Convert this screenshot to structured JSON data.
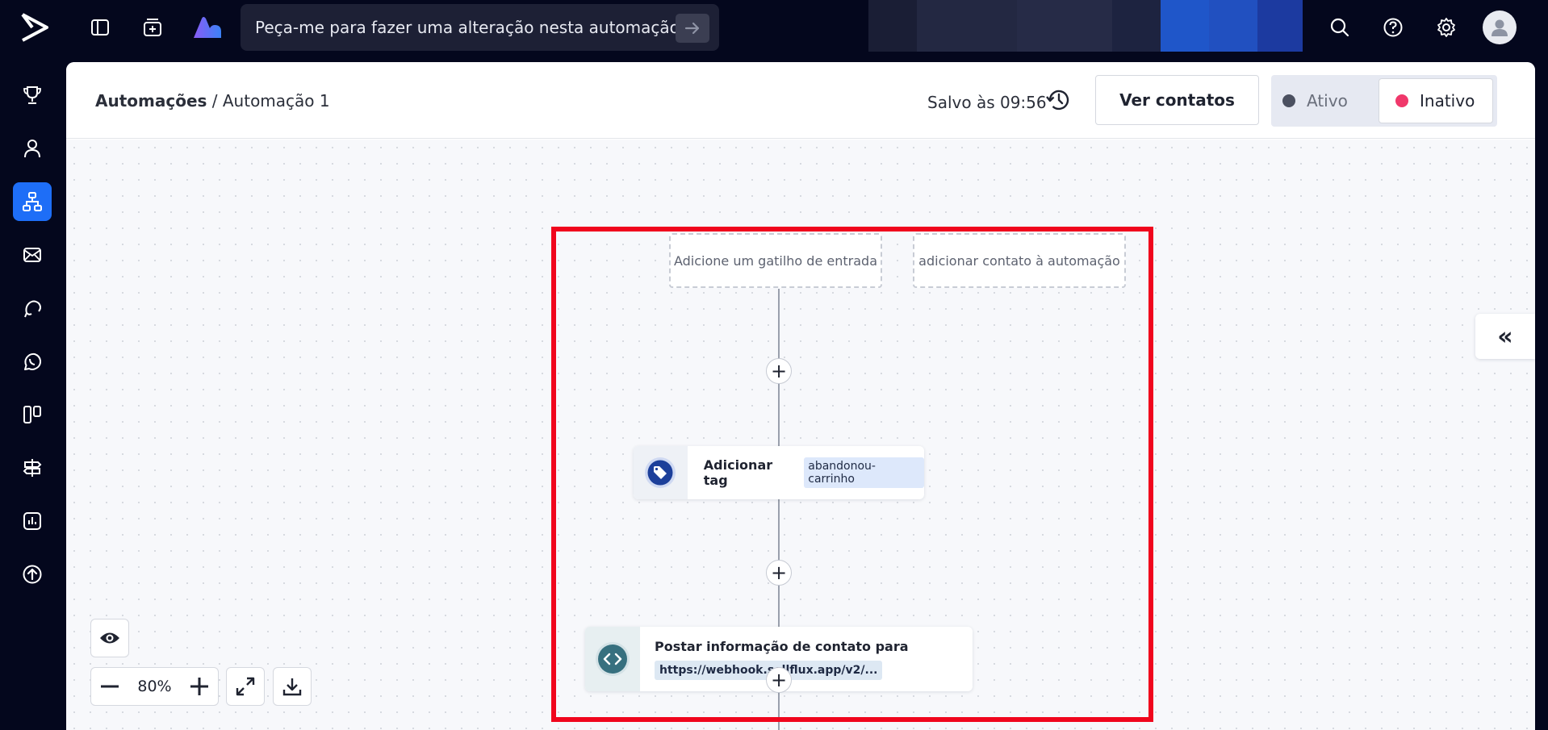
{
  "topbar": {
    "logo_icon": "brand-chevron-logo",
    "prompt_text": "Peça-me para fazer uma alteração nesta automação",
    "icons": [
      "sidebar-toggle-icon",
      "add-box-icon",
      "ai-app-icon",
      "search-icon",
      "help-icon",
      "gear-icon",
      "user-avatar-icon"
    ]
  },
  "sidebar": {
    "items": [
      {
        "icon": "trophy-icon",
        "active": false
      },
      {
        "icon": "person-icon",
        "active": false
      },
      {
        "icon": "automation-flow-icon",
        "active": true
      },
      {
        "icon": "mail-icon",
        "active": false
      },
      {
        "icon": "chat-bubble-icon",
        "active": false
      },
      {
        "icon": "whatsapp-icon",
        "active": false
      },
      {
        "icon": "kanban-icon",
        "active": false
      },
      {
        "icon": "signpost-icon",
        "active": false
      },
      {
        "icon": "chart-icon",
        "active": false
      },
      {
        "icon": "upload-circle-icon",
        "active": false
      }
    ]
  },
  "header": {
    "breadcrumb_root": "Automações",
    "breadcrumb_sep": " / ",
    "breadcrumb_current": "Automação 1",
    "saved_text": "Salvo às 09:56",
    "contacts_button": "Ver contatos",
    "toggle_active": "Ativo",
    "toggle_inactive": "Inativo",
    "colors": {
      "active_dot": "#4b5060",
      "inactive_dot": "#f0386b",
      "accent": "#1e6ef7"
    }
  },
  "canvas": {
    "trigger_entry": "Adicione um gatilho de entrada",
    "add_contact": "adicionar contato à automação",
    "node_tag": {
      "label": "Adicionar tag",
      "tag": "abandonou-carrinho"
    },
    "node_webhook": {
      "label": "Postar informação de contato para",
      "url": "https://webhook.sellflux.app/v2/..."
    },
    "zoom": "80%",
    "collapse_glyph": "«"
  }
}
